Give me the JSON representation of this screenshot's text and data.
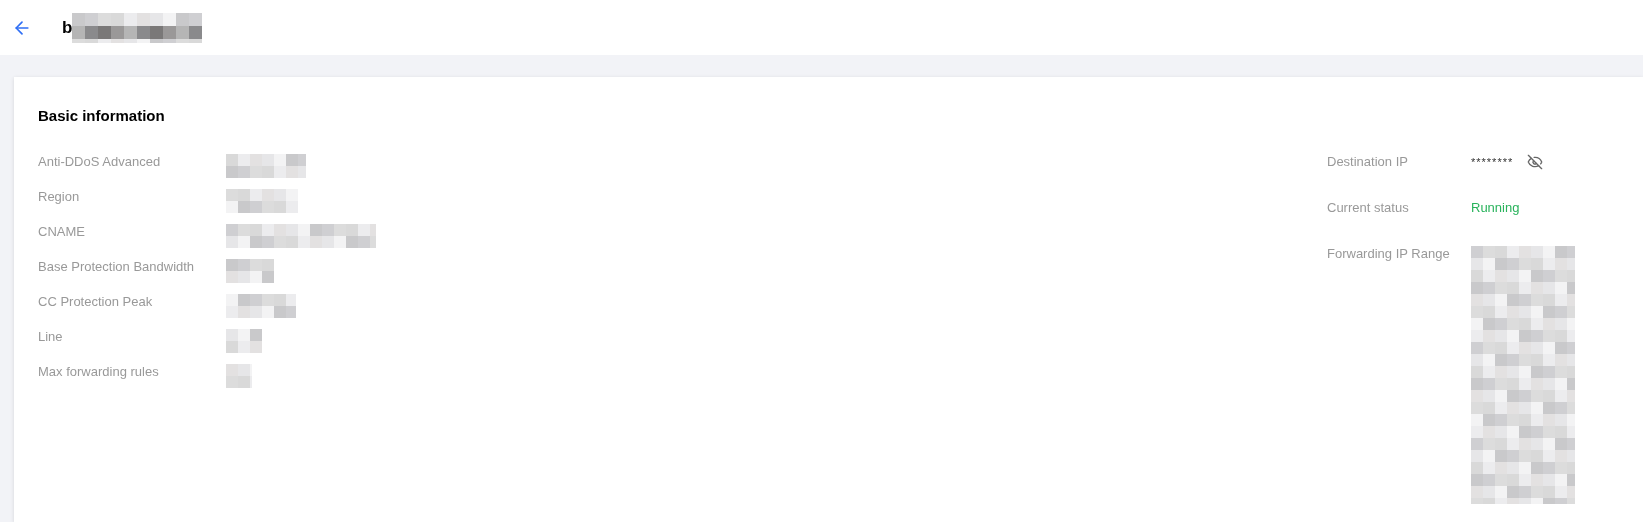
{
  "header": {
    "title_prefix": "b",
    "title_rest": {
      "kind": "redacted"
    }
  },
  "section": {
    "title": "Basic information"
  },
  "left_fields": [
    {
      "label": "Anti-DDoS Advanced",
      "value": {
        "kind": "redacted"
      }
    },
    {
      "label": "Region",
      "value": {
        "kind": "redacted"
      }
    },
    {
      "label": "CNAME",
      "value": {
        "kind": "redacted"
      }
    },
    {
      "label": "Base Protection Bandwidth",
      "value": {
        "kind": "redacted"
      }
    },
    {
      "label": "CC Protection Peak",
      "value": {
        "kind": "redacted"
      }
    },
    {
      "label": "Line",
      "value": {
        "kind": "redacted"
      }
    },
    {
      "label": "Max forwarding rules",
      "value": {
        "kind": "redacted"
      }
    }
  ],
  "right_fields": [
    {
      "label": "Destination IP",
      "value": {
        "kind": "masked",
        "text": "********"
      }
    },
    {
      "label": "Current status",
      "value": {
        "kind": "status",
        "text": "Running",
        "color": "#29b35c"
      }
    },
    {
      "label": "Forwarding IP Range",
      "value": {
        "kind": "redacted"
      }
    }
  ]
}
